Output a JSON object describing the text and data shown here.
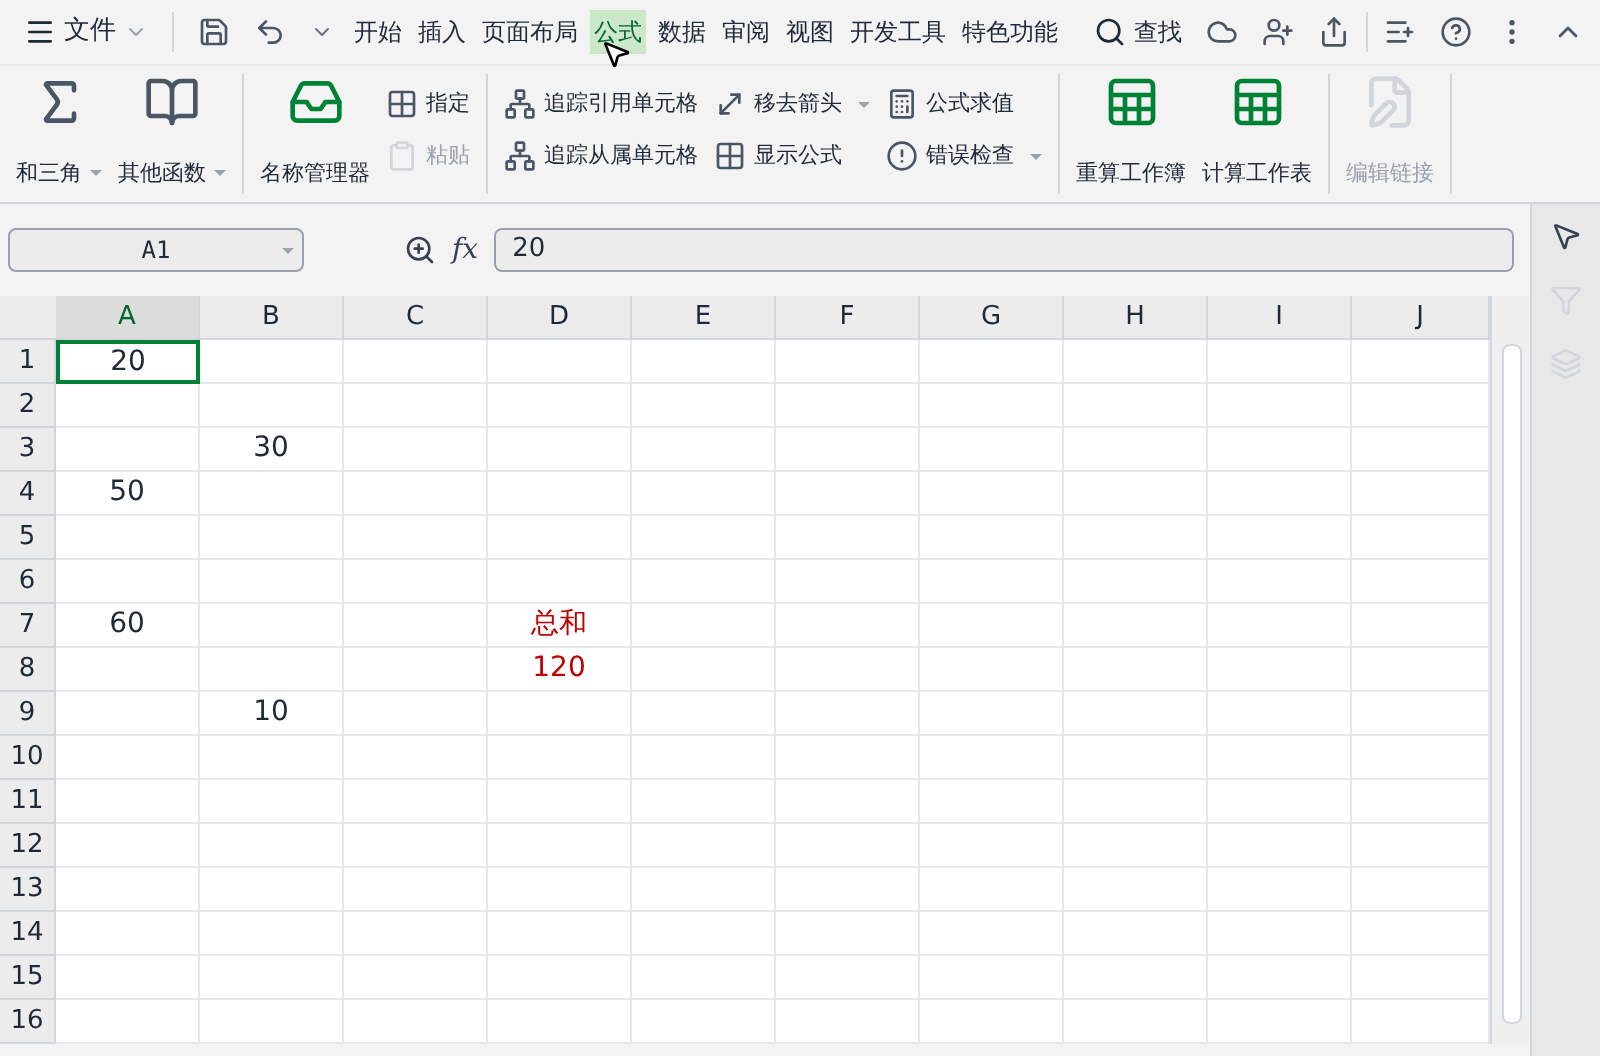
{
  "menu": {
    "file": "文件",
    "tabs": [
      {
        "label": "开始",
        "selected": false
      },
      {
        "label": "插入",
        "selected": false
      },
      {
        "label": "页面布局",
        "selected": false
      },
      {
        "label": "公式",
        "selected": true
      },
      {
        "label": "数据",
        "selected": false
      },
      {
        "label": "审阅",
        "selected": false
      },
      {
        "label": "视图",
        "selected": false
      },
      {
        "label": "开发工具",
        "selected": false
      },
      {
        "label": "特色功能",
        "selected": false
      }
    ],
    "search": "查找"
  },
  "ribbon": [
    {
      "items": [
        {
          "kind": "large",
          "label": "和三角",
          "menu": true,
          "disabled": false
        },
        {
          "kind": "large",
          "label": "其他函数",
          "menu": true,
          "disabled": false
        }
      ]
    },
    {
      "items": [
        {
          "kind": "large",
          "label": "名称管理器",
          "menu": false,
          "disabled": false
        },
        {
          "kind": "stack",
          "children": [
            {
              "label": "指定",
              "menu": false,
              "disabled": false
            },
            {
              "label": "粘贴",
              "menu": false,
              "disabled": true
            }
          ]
        }
      ]
    },
    {
      "items": [
        {
          "kind": "stack",
          "children": [
            {
              "label": "追踪引用单元格",
              "menu": false,
              "disabled": false
            },
            {
              "label": "追踪从属单元格",
              "menu": false,
              "disabled": false
            }
          ]
        },
        {
          "kind": "stack",
          "children": [
            {
              "label": "移去箭头",
              "menu": true,
              "disabled": false
            },
            {
              "label": "显示公式",
              "menu": false,
              "disabled": false
            }
          ]
        },
        {
          "kind": "stack",
          "children": [
            {
              "label": "公式求值",
              "menu": false,
              "disabled": false
            },
            {
              "label": "错误检查",
              "menu": true,
              "disabled": false
            }
          ]
        }
      ]
    },
    {
      "items": [
        {
          "kind": "large",
          "label": "重算工作簿",
          "menu": false,
          "disabled": false
        },
        {
          "kind": "large",
          "label": "计算工作表",
          "menu": false,
          "disabled": false
        }
      ]
    },
    {
      "items": [
        {
          "kind": "large",
          "label": "编辑链接",
          "menu": false,
          "disabled": true
        }
      ]
    }
  ],
  "formula_bar": {
    "name_box": "A1",
    "fx": "fx",
    "value": "20"
  },
  "sheet": {
    "columns": [
      {
        "label": "A",
        "selected": true
      },
      {
        "label": "B",
        "selected": false
      },
      {
        "label": "C",
        "selected": false
      },
      {
        "label": "D",
        "selected": false
      },
      {
        "label": "E",
        "selected": false
      },
      {
        "label": "F",
        "selected": false
      },
      {
        "label": "G",
        "selected": false
      },
      {
        "label": "H",
        "selected": false
      },
      {
        "label": "I",
        "selected": false
      },
      {
        "label": "J",
        "selected": false
      }
    ],
    "rows": [
      {
        "label": "1",
        "cells": [
          {
            "value": "20",
            "selected": true
          },
          {},
          {},
          {},
          {},
          {},
          {},
          {},
          {},
          {}
        ]
      },
      {
        "label": "2",
        "cells": [
          {},
          {},
          {},
          {},
          {},
          {},
          {},
          {},
          {},
          {}
        ]
      },
      {
        "label": "3",
        "cells": [
          {},
          {
            "value": "30"
          },
          {},
          {},
          {},
          {},
          {},
          {},
          {},
          {}
        ]
      },
      {
        "label": "4",
        "cells": [
          {
            "value": "50"
          },
          {},
          {},
          {},
          {},
          {},
          {},
          {},
          {},
          {}
        ]
      },
      {
        "label": "5",
        "cells": [
          {},
          {},
          {},
          {},
          {},
          {},
          {},
          {},
          {},
          {}
        ]
      },
      {
        "label": "6",
        "cells": [
          {},
          {},
          {},
          {},
          {},
          {},
          {},
          {},
          {},
          {}
        ]
      },
      {
        "label": "7",
        "cells": [
          {
            "value": "60"
          },
          {},
          {},
          {
            "value": "总和",
            "color": "#c00000"
          },
          {},
          {},
          {},
          {},
          {},
          {}
        ]
      },
      {
        "label": "8",
        "cells": [
          {},
          {},
          {},
          {
            "value": "120",
            "color": "#c00000"
          },
          {},
          {},
          {},
          {},
          {},
          {}
        ]
      },
      {
        "label": "9",
        "cells": [
          {},
          {
            "value": "10"
          },
          {},
          {},
          {},
          {},
          {},
          {},
          {},
          {}
        ]
      },
      {
        "label": "10",
        "cells": [
          {},
          {},
          {},
          {},
          {},
          {},
          {},
          {},
          {},
          {}
        ]
      },
      {
        "label": "11",
        "cells": [
          {},
          {},
          {},
          {},
          {},
          {},
          {},
          {},
          {},
          {}
        ]
      },
      {
        "label": "12",
        "cells": [
          {},
          {},
          {},
          {},
          {},
          {},
          {},
          {},
          {},
          {}
        ]
      },
      {
        "label": "13",
        "cells": [
          {},
          {},
          {},
          {},
          {},
          {},
          {},
          {},
          {},
          {}
        ]
      },
      {
        "label": "14",
        "cells": [
          {},
          {},
          {},
          {},
          {},
          {},
          {},
          {},
          {},
          {}
        ]
      },
      {
        "label": "15",
        "cells": [
          {},
          {},
          {},
          {},
          {},
          {},
          {},
          {},
          {},
          {}
        ]
      },
      {
        "label": "16",
        "cells": [
          {},
          {},
          {},
          {},
          {},
          {},
          {},
          {},
          {},
          {}
        ]
      }
    ]
  }
}
